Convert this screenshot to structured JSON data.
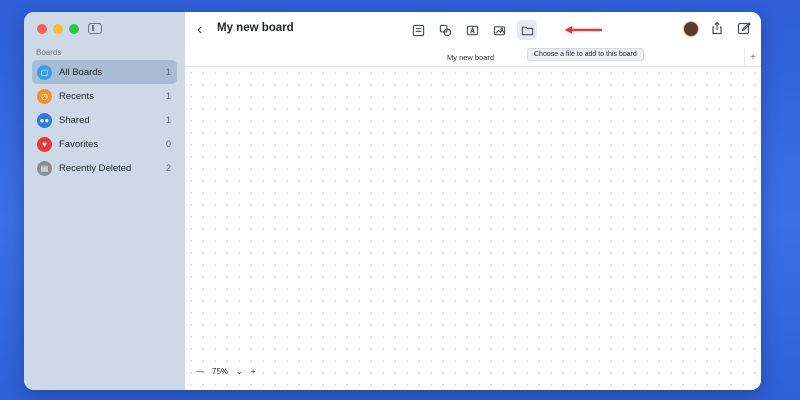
{
  "sidebar": {
    "section_label": "Boards",
    "items": [
      {
        "label": "All Boards",
        "count": "1",
        "icon": "all-boards-icon",
        "color": "#36a1e8"
      },
      {
        "label": "Recents",
        "count": "1",
        "icon": "clock-icon",
        "color": "#f0932b"
      },
      {
        "label": "Shared",
        "count": "1",
        "icon": "people-icon",
        "color": "#2d7be0"
      },
      {
        "label": "Favorites",
        "count": "0",
        "icon": "heart-icon",
        "color": "#e53935"
      },
      {
        "label": "Recently Deleted",
        "count": "2",
        "icon": "trash-icon",
        "color": "#8b9098"
      }
    ]
  },
  "header": {
    "title": "My new board",
    "tab_label": "My new board",
    "tooltip": "Choose a file to add to this board"
  },
  "zoom": {
    "minus": "—",
    "level": "75%",
    "chevron": "⌄",
    "plus": "+"
  },
  "colors": {
    "accent_arrow": "#e03b3b",
    "selected_row": "#a8bdd2"
  }
}
